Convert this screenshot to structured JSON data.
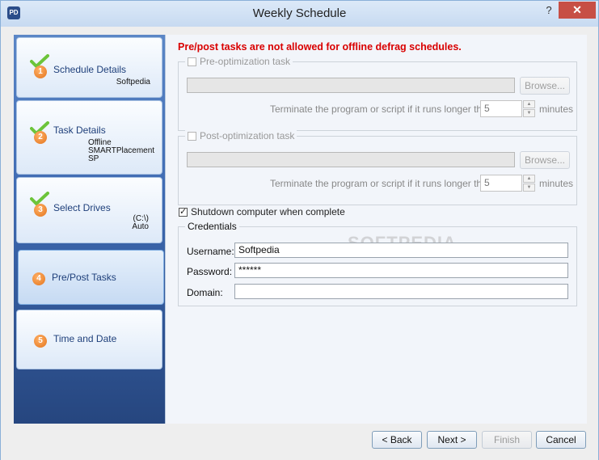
{
  "window": {
    "title": "Weekly Schedule",
    "app_icon_text": "PD",
    "help_label": "?",
    "close_label": "✕"
  },
  "steps": [
    {
      "number": "1",
      "title": "Schedule Details",
      "sub": [
        "Softpedia"
      ],
      "completed": true
    },
    {
      "number": "2",
      "title": "Task Details",
      "sub": [
        "Offline",
        "SMARTPlacement",
        "SP"
      ],
      "completed": true
    },
    {
      "number": "3",
      "title": "Select Drives",
      "sub": [
        "(C:\\)",
        "Auto"
      ],
      "completed": true
    },
    {
      "number": "4",
      "title": "Pre/Post Tasks",
      "sub": [],
      "completed": false,
      "active": true
    },
    {
      "number": "5",
      "title": "Time and Date",
      "sub": [],
      "completed": false
    }
  ],
  "content": {
    "warning": "Pre/post tasks are not allowed for offline defrag schedules.",
    "pre_task": {
      "label": "Pre-optimization task",
      "checked": false,
      "browse_label": "Browse...",
      "terminate_label": "Terminate the program or script if it runs longer than",
      "minutes_value": "5",
      "minutes_label": "minutes"
    },
    "post_task": {
      "label": "Post-optimization task",
      "checked": false,
      "browse_label": "Browse...",
      "terminate_label": "Terminate the program or script if it runs longer than",
      "minutes_value": "5",
      "minutes_label": "minutes"
    },
    "shutdown": {
      "label": "Shutdown computer when complete",
      "checked": true
    },
    "credentials": {
      "legend": "Credentials",
      "username_label": "Username:",
      "username_value": "Softpedia",
      "password_label": "Password:",
      "password_value": "******",
      "domain_label": "Domain:",
      "domain_value": ""
    },
    "watermark": "SOFTPEDIA"
  },
  "footer": {
    "back_label": "< Back",
    "next_label": "Next >",
    "finish_label": "Finish",
    "cancel_label": "Cancel"
  },
  "colors": {
    "warning": "#d90000",
    "accent": "#2b4d8a",
    "close": "#c74f45",
    "badge": "#e3741c"
  }
}
